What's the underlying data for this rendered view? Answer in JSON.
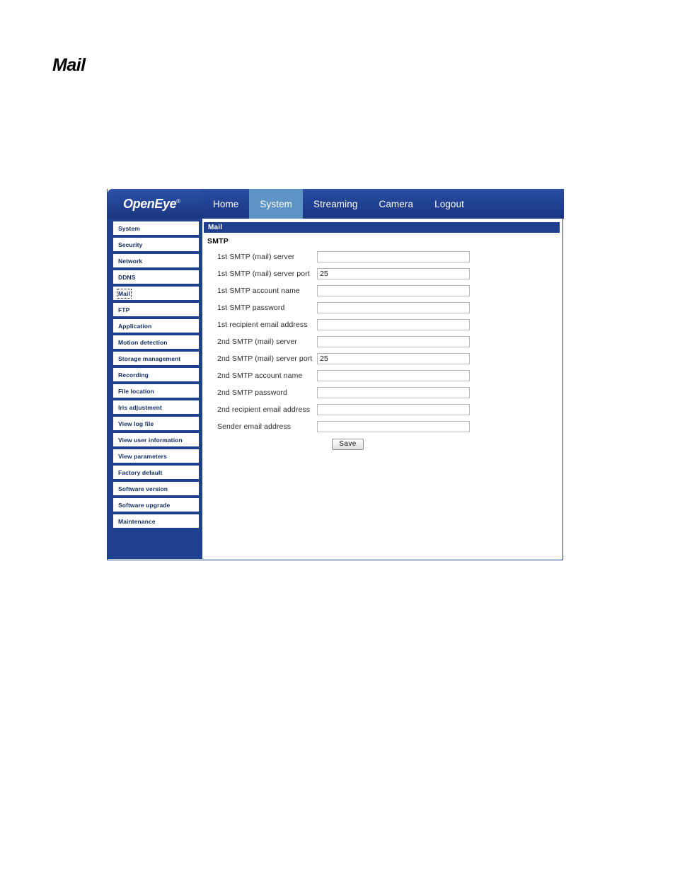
{
  "document": {
    "title": "Mail"
  },
  "browser_ui": {
    "brand": {
      "name": "OpenEye",
      "trademark": "®"
    },
    "nav": [
      {
        "label": "Home",
        "active": false
      },
      {
        "label": "System",
        "active": true
      },
      {
        "label": "Streaming",
        "active": false
      },
      {
        "label": "Camera",
        "active": false
      },
      {
        "label": "Logout",
        "active": false
      }
    ],
    "colors": {
      "brand_blue": "#1f3f8f",
      "active_tab": "#5e93c6",
      "panel_banner": "#1f3f8f",
      "sidebar_text": "#132d63"
    }
  },
  "sidebar": {
    "items": [
      {
        "label": "System",
        "focused": false
      },
      {
        "label": "Security",
        "focused": false
      },
      {
        "label": "Network",
        "focused": false
      },
      {
        "label": "DDNS",
        "focused": false
      },
      {
        "label": "Mail",
        "focused": true
      },
      {
        "label": "FTP",
        "focused": false
      },
      {
        "label": "Application",
        "focused": false
      },
      {
        "label": "Motion detection",
        "focused": false
      },
      {
        "label": "Storage management",
        "focused": false
      },
      {
        "label": "Recording",
        "focused": false
      },
      {
        "label": "File location",
        "focused": false
      },
      {
        "label": "Iris adjustment",
        "focused": false
      },
      {
        "label": "View log file",
        "focused": false
      },
      {
        "label": "View user information",
        "focused": false
      },
      {
        "label": "View parameters",
        "focused": false
      },
      {
        "label": "Factory default",
        "focused": false
      },
      {
        "label": "Software version",
        "focused": false
      },
      {
        "label": "Software upgrade",
        "focused": false
      },
      {
        "label": "Maintenance",
        "focused": false
      }
    ]
  },
  "panel": {
    "banner_title": "Mail",
    "section_title": "SMTP",
    "fields": [
      {
        "label": "1st SMTP (mail) server",
        "value": ""
      },
      {
        "label": "1st SMTP (mail) server port",
        "value": "25"
      },
      {
        "label": "1st SMTP account name",
        "value": ""
      },
      {
        "label": "1st SMTP password",
        "value": ""
      },
      {
        "label": "1st recipient email address",
        "value": ""
      },
      {
        "label": "2nd SMTP (mail) server",
        "value": ""
      },
      {
        "label": "2nd SMTP (mail) server port",
        "value": "25"
      },
      {
        "label": "2nd SMTP account name",
        "value": ""
      },
      {
        "label": "2nd SMTP password",
        "value": ""
      },
      {
        "label": "2nd recipient email address",
        "value": ""
      },
      {
        "label": "Sender email address",
        "value": ""
      }
    ],
    "save_label": "Save"
  }
}
